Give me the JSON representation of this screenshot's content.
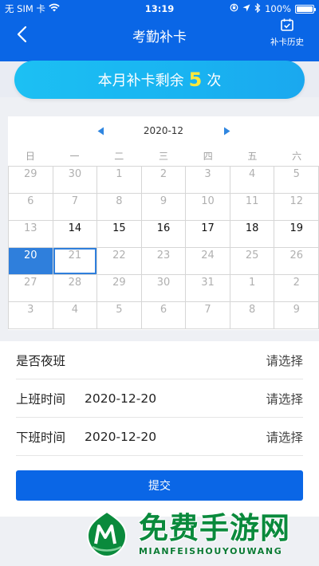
{
  "status_bar": {
    "carrier": "无 SIM 卡",
    "time": "13:19",
    "battery": "100%"
  },
  "header": {
    "title": "考勤补卡",
    "history_label": "补卡历史",
    "icons": {
      "back": "chevron-left-icon",
      "history": "calendar-check-icon"
    }
  },
  "banner": {
    "prefix": "本月补卡剩余",
    "count": "5",
    "suffix": "次"
  },
  "calendar": {
    "month": "2020-12",
    "weekdays": [
      "日",
      "一",
      "二",
      "三",
      "四",
      "五",
      "六"
    ],
    "days": [
      {
        "d": "29",
        "cur": false
      },
      {
        "d": "30",
        "cur": false
      },
      {
        "d": "1",
        "cur": false
      },
      {
        "d": "2",
        "cur": false
      },
      {
        "d": "3",
        "cur": false
      },
      {
        "d": "4",
        "cur": false
      },
      {
        "d": "5",
        "cur": false
      },
      {
        "d": "6",
        "cur": false
      },
      {
        "d": "7",
        "cur": false
      },
      {
        "d": "8",
        "cur": false
      },
      {
        "d": "9",
        "cur": false
      },
      {
        "d": "10",
        "cur": false
      },
      {
        "d": "11",
        "cur": false
      },
      {
        "d": "12",
        "cur": false
      },
      {
        "d": "13",
        "cur": false
      },
      {
        "d": "14",
        "cur": true
      },
      {
        "d": "15",
        "cur": true
      },
      {
        "d": "16",
        "cur": true
      },
      {
        "d": "17",
        "cur": true
      },
      {
        "d": "18",
        "cur": true
      },
      {
        "d": "19",
        "cur": true
      },
      {
        "d": "20",
        "cur": false,
        "selected": true
      },
      {
        "d": "21",
        "cur": false,
        "today": true
      },
      {
        "d": "22",
        "cur": false
      },
      {
        "d": "23",
        "cur": false
      },
      {
        "d": "24",
        "cur": false
      },
      {
        "d": "25",
        "cur": false
      },
      {
        "d": "26",
        "cur": false
      },
      {
        "d": "27",
        "cur": false
      },
      {
        "d": "28",
        "cur": false
      },
      {
        "d": "29",
        "cur": false
      },
      {
        "d": "30",
        "cur": false
      },
      {
        "d": "31",
        "cur": false
      },
      {
        "d": "1",
        "cur": false
      },
      {
        "d": "2",
        "cur": false
      },
      {
        "d": "3",
        "cur": false
      },
      {
        "d": "4",
        "cur": false
      },
      {
        "d": "5",
        "cur": false
      },
      {
        "d": "6",
        "cur": false
      },
      {
        "d": "7",
        "cur": false
      },
      {
        "d": "8",
        "cur": false
      },
      {
        "d": "9",
        "cur": false
      }
    ]
  },
  "form": {
    "night_shift_label": "是否夜班",
    "night_shift_value": "请选择",
    "start_label": "上班时间",
    "start_date": "2020-12-20",
    "start_value": "请选择",
    "end_label": "下班时间",
    "end_date": "2020-12-20",
    "end_value": "请选择",
    "submit_label": "提交"
  },
  "watermark": {
    "title": "免费手游网",
    "subtitle": "MIANFEISHOUYOUWANG"
  },
  "colors": {
    "primary": "#0a66e6",
    "banner": "#1cc0f3",
    "count": "#ffe83a",
    "selected_day": "#2f7fdc",
    "watermark_green": "#0a8a3c"
  }
}
